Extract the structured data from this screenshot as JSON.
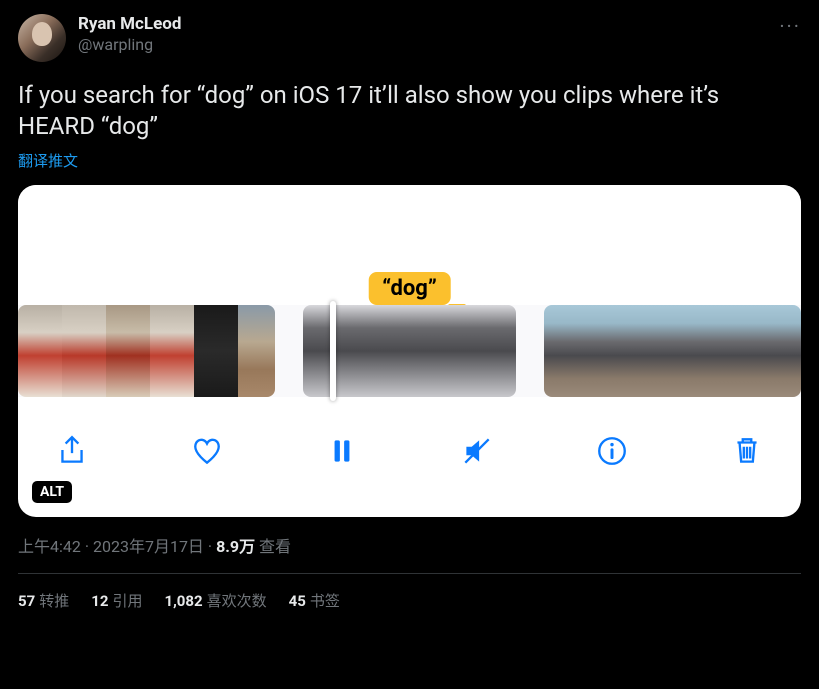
{
  "user": {
    "display_name": "Ryan McLeod",
    "handle": "@warpling"
  },
  "more_label": "···",
  "tweet_text": "If you search for “dog” on iOS 17 it’ll also show you clips where it’s HEARD “dog”",
  "translate": "翻译推文",
  "media": {
    "badge": "“dog”",
    "alt": "ALT",
    "toolbar": {
      "share": "share",
      "like": "like",
      "pause": "pause",
      "mute": "mute",
      "info": "info",
      "delete": "delete"
    }
  },
  "meta": {
    "time": "上午4:42",
    "dot1": " · ",
    "date": "2023年7月17日",
    "dot2": " · ",
    "views_num": "8.9万",
    "views_label": " 查看"
  },
  "stats": {
    "retweets_num": "57",
    "retweets_label": "转推",
    "quotes_num": "12",
    "quotes_label": "引用",
    "likes_num": "1,082",
    "likes_label": "喜欢次数",
    "bookmarks_num": "45",
    "bookmarks_label": "书签"
  }
}
